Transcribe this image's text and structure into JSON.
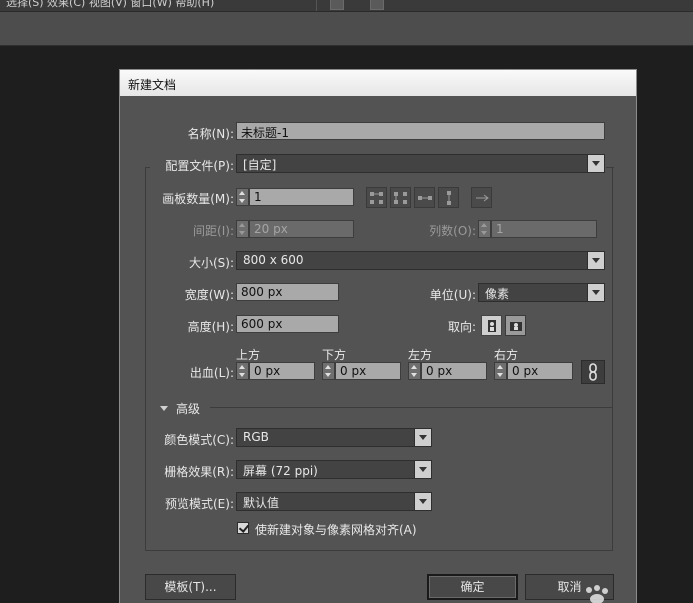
{
  "menubar": {
    "items_text": "选择(S)  效果(C)  视图(V)  窗口(W)  帮助(H)"
  },
  "dialog": {
    "title": "新建文档",
    "name": {
      "label": "名称(N):",
      "value": "未标题-1"
    },
    "profile": {
      "label": "配置文件(P):",
      "value": "[自定]"
    },
    "artboards": {
      "label": "画板数量(M):",
      "value": "1"
    },
    "spacing": {
      "label": "间距(I):",
      "value": "20 px"
    },
    "columns": {
      "label": "列数(O):",
      "value": "1"
    },
    "size": {
      "label": "大小(S):",
      "value": "800 x 600"
    },
    "width": {
      "label": "宽度(W):",
      "value": "800 px"
    },
    "units": {
      "label": "单位(U):",
      "value": "像素"
    },
    "height": {
      "label": "高度(H):",
      "value": "600 px"
    },
    "orientation": {
      "label": "取向:"
    },
    "bleed": {
      "label": "出血(L):",
      "top": {
        "label": "上方",
        "value": "0 px"
      },
      "bottom": {
        "label": "下方",
        "value": "0 px"
      },
      "left": {
        "label": "左方",
        "value": "0 px"
      },
      "right": {
        "label": "右方",
        "value": "0 px"
      }
    },
    "advanced": {
      "label": "高级"
    },
    "color_mode": {
      "label": "颜色模式(C):",
      "value": "RGB"
    },
    "raster_effects": {
      "label": "栅格效果(R):",
      "value": "屏幕 (72 ppi)"
    },
    "preview_mode": {
      "label": "预览模式(E):",
      "value": "默认值"
    },
    "align_pixel": {
      "label": "使新建对象与像素网格对齐(A)",
      "checked": true
    },
    "buttons": {
      "templates": "模板(T)...",
      "ok": "确定",
      "cancel": "取消"
    }
  }
}
